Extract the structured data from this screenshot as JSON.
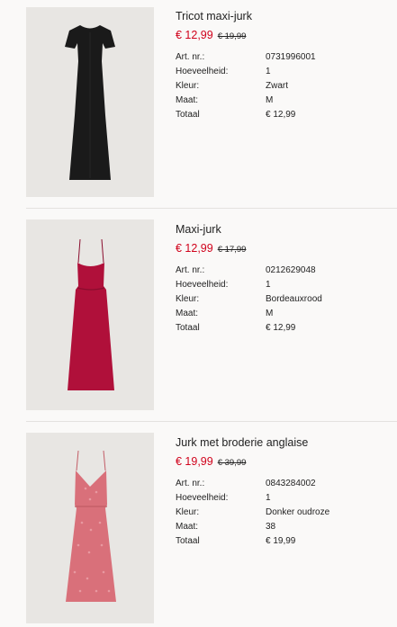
{
  "colors": {
    "sale_red": "#d0021b",
    "text": "#222222",
    "background": "#faf9f8",
    "divider": "#e4e2e0"
  },
  "items": [
    {
      "title": "Tricot maxi-jurk",
      "price_now": "€ 12,99",
      "price_was": "€ 19,99",
      "details": [
        {
          "label": "Art. nr.:",
          "value": "0731996001"
        },
        {
          "label": "Hoeveelheid:",
          "value": "1"
        },
        {
          "label": "Kleur:",
          "value": "Zwart"
        },
        {
          "label": "Maat:",
          "value": "M"
        },
        {
          "label": "Totaal",
          "value": "€ 12,99"
        }
      ],
      "image_icon": "black-tshirt-maxi-dress",
      "dress_color": "#1a1a1a"
    },
    {
      "title": "Maxi-jurk",
      "price_now": "€ 12,99",
      "price_was": "€ 17,99",
      "details": [
        {
          "label": "Art. nr.:",
          "value": "0212629048"
        },
        {
          "label": "Hoeveelheid:",
          "value": "1"
        },
        {
          "label": "Kleur:",
          "value": "Bordeauxrood"
        },
        {
          "label": "Maat:",
          "value": "M"
        },
        {
          "label": "Totaal",
          "value": "€ 12,99"
        }
      ],
      "image_icon": "burgundy-strappy-maxi-dress",
      "dress_color": "#b0103a"
    },
    {
      "title": "Jurk met broderie anglaise",
      "price_now": "€ 19,99",
      "price_was": "€ 39,99",
      "details": [
        {
          "label": "Art. nr.:",
          "value": "0843284002"
        },
        {
          "label": "Hoeveelheid:",
          "value": "1"
        },
        {
          "label": "Kleur:",
          "value": "Donker oudroze"
        },
        {
          "label": "Maat:",
          "value": "38"
        },
        {
          "label": "Totaal",
          "value": "€ 19,99"
        }
      ],
      "image_icon": "pink-broderie-dress",
      "dress_color": "#d9707a"
    }
  ]
}
